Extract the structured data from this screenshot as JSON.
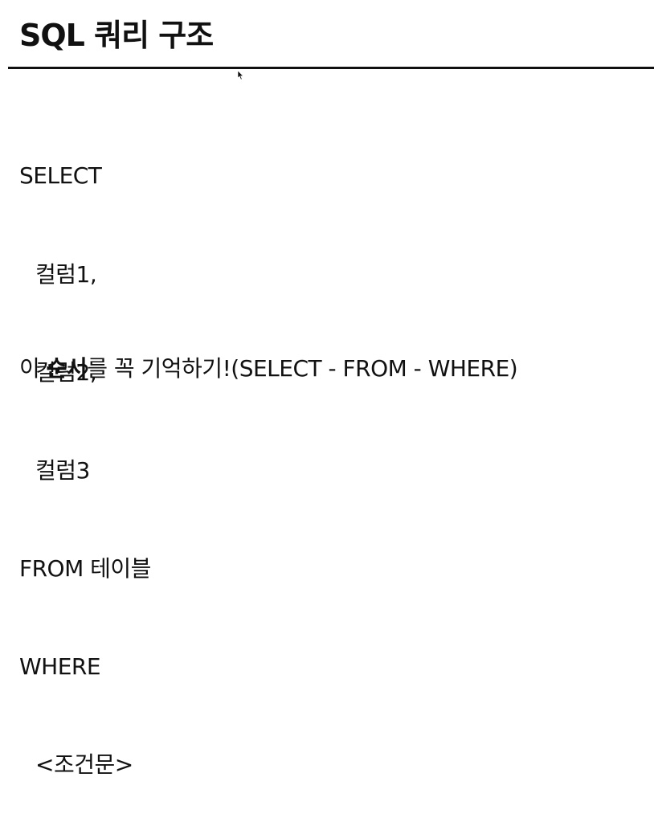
{
  "slide": {
    "title": "SQL 쿼리 구조"
  },
  "query": {
    "lines": [
      "SELECT",
      "컬럼1,",
      "컬럼2,",
      "컬럼3",
      "FROM 테이블",
      "WHERE",
      "<조건문>"
    ]
  },
  "note": {
    "prefix": "이 ",
    "emphasis": "순서",
    "suffix": "를 꼭 기억하기!(SELECT - FROM - WHERE)"
  }
}
